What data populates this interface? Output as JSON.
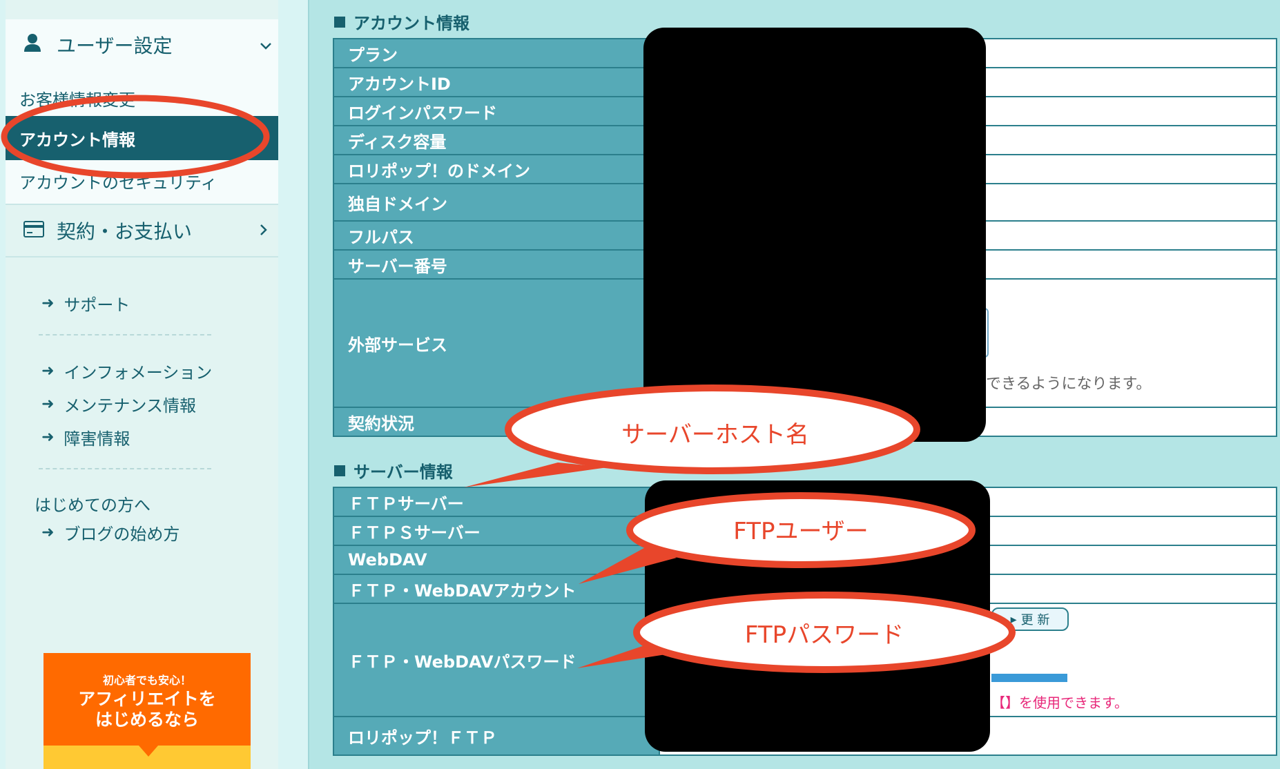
{
  "sidebar": {
    "user_settings": {
      "label": "ユーザー設定",
      "chevron": "∨"
    },
    "user_items": [
      {
        "label": "お客様情報変更"
      },
      {
        "label": "アカウント情報"
      },
      {
        "label": "アカウントのセキュリティ"
      }
    ],
    "contract": {
      "label": "契約・お支払い",
      "chevron": "›"
    },
    "links_a": [
      {
        "label": "サポート"
      }
    ],
    "links_b": [
      {
        "label": "インフォメーション"
      },
      {
        "label": "メンテナンス情報"
      },
      {
        "label": "障害情報"
      }
    ],
    "first_time": "はじめての方へ",
    "links_c": [
      {
        "label": "ブログの始め方"
      }
    ],
    "promo": {
      "small": "初心者でも安心！",
      "line1": "アフィリエイトを",
      "line2": "はじめるなら"
    },
    "arrow_glyph": "➜"
  },
  "account_info": {
    "title": "アカウント情報",
    "rows": [
      "プラン",
      "アカウントID",
      "ログインパスワード",
      "ディスク容量",
      "ロリポップ！のドメイン",
      "独自ドメイン",
      "フルパス",
      "サーバー番号",
      "外部サービス",
      "契約状況"
    ],
    "external_note": "できるようになります。"
  },
  "server_info": {
    "title": "サーバー情報",
    "rows": [
      "ＦＴＰサーバー",
      "ＦＴＰＳサーバー",
      "WebDAV",
      "ＦＴＰ・WebDAVアカウント",
      "ＦＴＰ・WebDAVパスワード",
      "ロリポップ！ＦＴＰ"
    ],
    "update_button": "更 新",
    "password_note_bracket": "【】",
    "password_note": "を使用できます。"
  },
  "annotations": {
    "server_host": "サーバーホスト名",
    "ftp_user": "FTPユーザー",
    "ftp_password": "FTPパスワード"
  },
  "colors": {
    "accent": "#17606e",
    "table_header": "#56aab7",
    "annotation": "#e8462b",
    "promo": "#ff6a00"
  },
  "icons": [
    "user-icon",
    "chevron-down-icon",
    "credit-card-icon",
    "chevron-right-icon",
    "arrow-right-icon"
  ]
}
